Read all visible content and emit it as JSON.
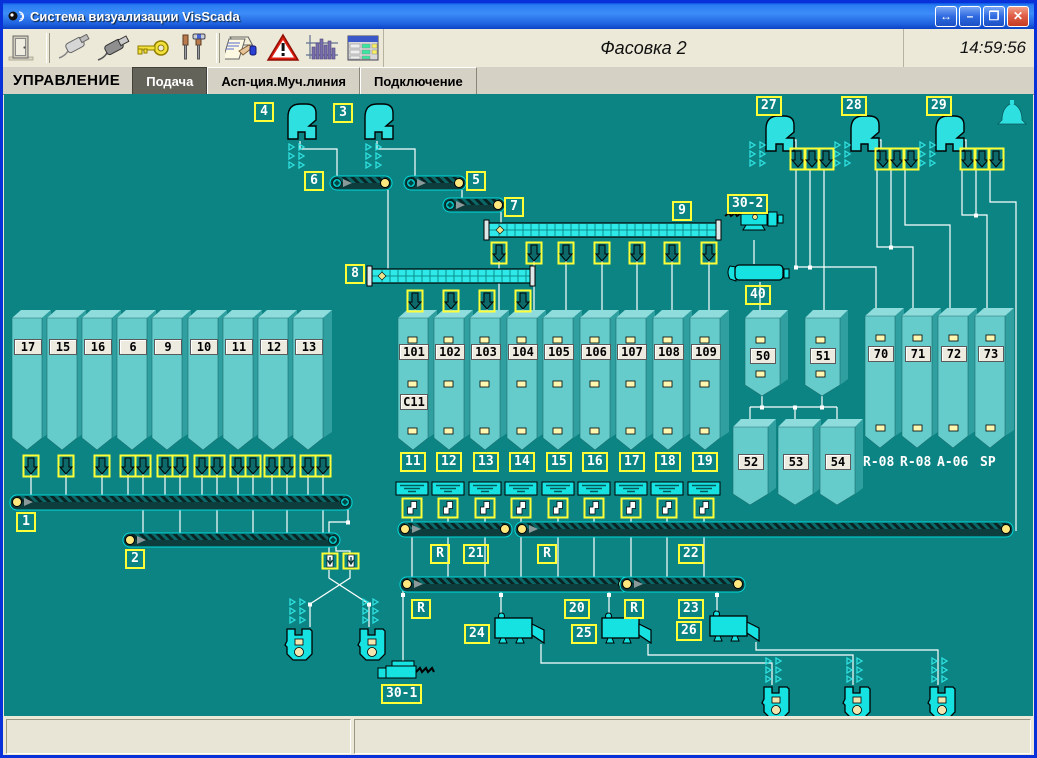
{
  "window": {
    "title": "Система визуализации VisScada",
    "buttons": {
      "restore": "↔",
      "minimize": "–",
      "maximize": "❒",
      "close": "✕"
    }
  },
  "toolbar": {
    "caption": "Фасовка 2",
    "time": "14:59:56",
    "icons": [
      "exit-door-icon",
      "connector-offline-icon",
      "connector-online-icon",
      "key-icon",
      "tools-icon",
      "report-icon",
      "alarm-icon",
      "trend-chart-icon",
      "data-table-icon"
    ]
  },
  "tabs": {
    "control_label": "УПРАВЛЕНИЕ",
    "items": [
      "Подача",
      "Асп-ция.Муч.линия",
      "Подключение"
    ]
  },
  "scheme": {
    "tags": {
      "n1": "1",
      "n2": "2",
      "n3": "3",
      "n4": "4",
      "n5": "5",
      "n6": "6",
      "n7": "7",
      "n8": "8",
      "n9": "9",
      "n20": "20",
      "n21": "21",
      "n22": "22",
      "n23": "23",
      "n24": "24",
      "n25": "25",
      "n26": "26",
      "n27": "27",
      "n28": "28",
      "n29": "29",
      "n30_1": "30-1",
      "n30_2": "30-2",
      "n40": "40",
      "r": "R"
    },
    "feeder_tags": [
      "11",
      "12",
      "13",
      "14",
      "15",
      "16",
      "17",
      "18",
      "19"
    ],
    "left_silos": [
      "17",
      "15",
      "16",
      "6",
      "9",
      "10",
      "11",
      "12",
      "13"
    ],
    "mid_silos": [
      "101",
      "102",
      "103",
      "104",
      "105",
      "106",
      "107",
      "108",
      "109"
    ],
    "c11": "C11",
    "bins": [
      "50",
      "51"
    ],
    "lower_bins": [
      "52",
      "53",
      "54"
    ],
    "packing_silos": [
      "70",
      "71",
      "72",
      "73"
    ],
    "packing_names": [
      "R-08",
      "R-08",
      "A-06",
      "SP"
    ]
  },
  "statusbar": {
    "left": "",
    "right": ""
  },
  "colors": {
    "canvas_teal": "#0D8484",
    "device_cyan": "#2FE3E3",
    "tag_yellow": "#FFFF37",
    "line_white": "#FFFFFF",
    "silo_front": "#66CBCB",
    "silo_side": "#2F9F9F",
    "silo_top": "#8FDCDC",
    "plate_bg": "#EDEAE0",
    "alarm_red": "#D42A1E",
    "titlebar_blue": "#2A7DF2"
  }
}
